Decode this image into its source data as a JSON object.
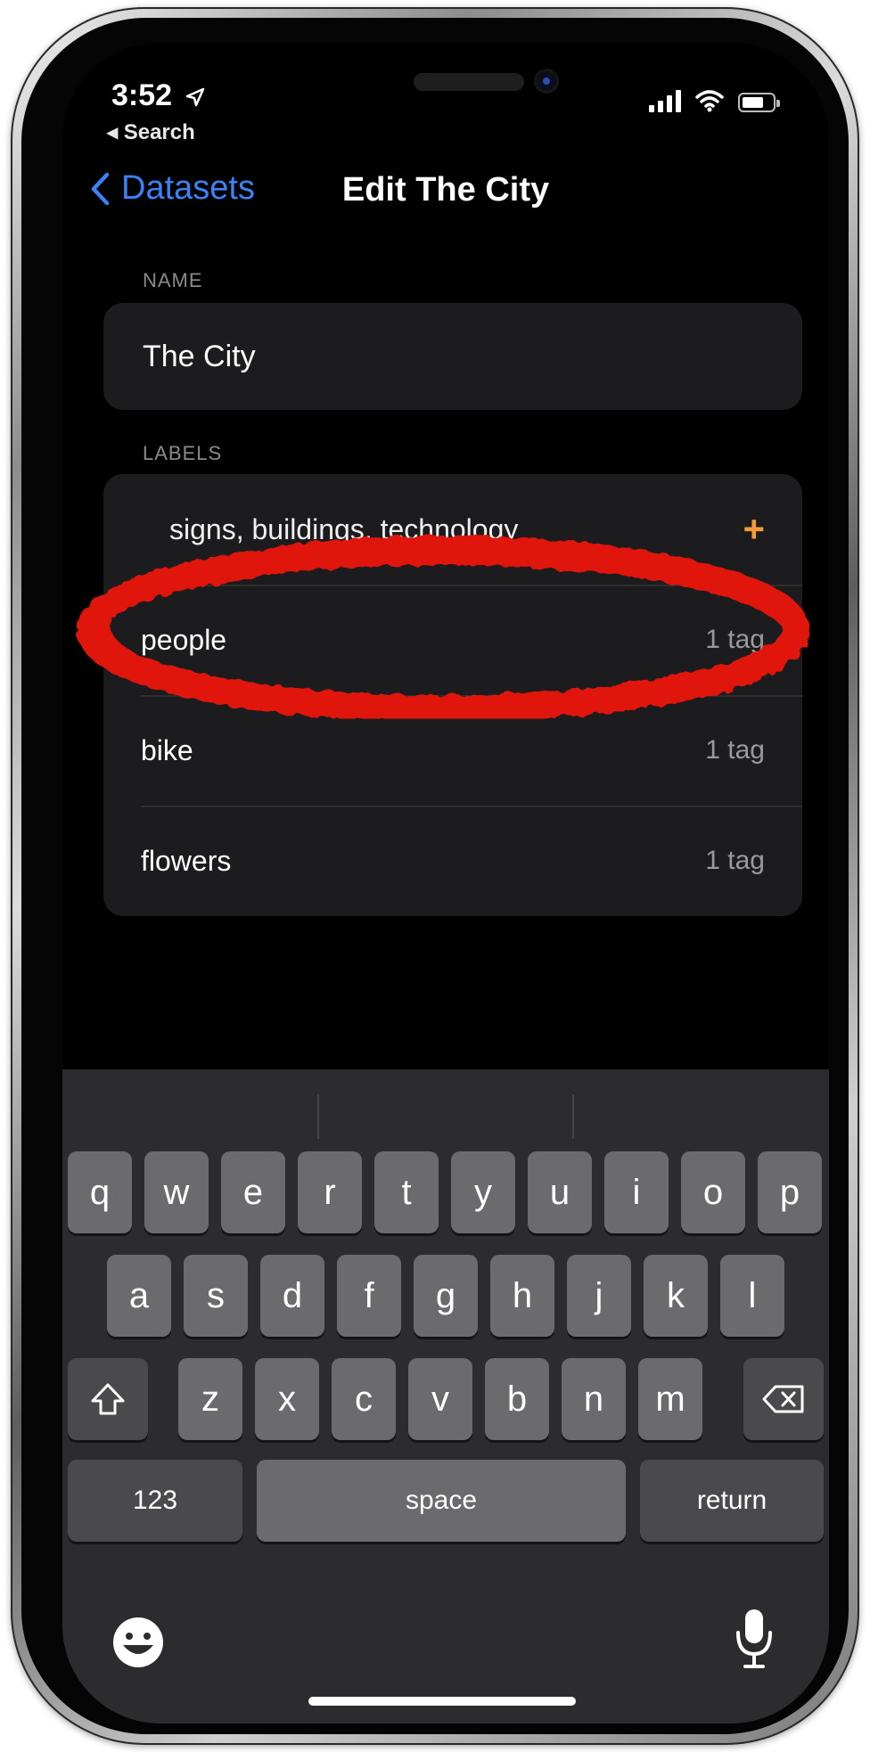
{
  "status": {
    "time": "3:52",
    "back_app": "◂ Search"
  },
  "nav": {
    "back_label": "Datasets",
    "title": "Edit The City"
  },
  "name_section": {
    "header": "NAME",
    "value": "The City"
  },
  "labels_section": {
    "header": "LABELS",
    "new_label_value": "signs, buildings, technology",
    "add_icon": "plus-icon",
    "items": [
      {
        "label": "people",
        "count": "1 tag"
      },
      {
        "label": "bike",
        "count": "1 tag"
      },
      {
        "label": "flowers",
        "count": "1 tag"
      }
    ]
  },
  "keyboard": {
    "row1": [
      "q",
      "w",
      "e",
      "r",
      "t",
      "y",
      "u",
      "i",
      "o",
      "p"
    ],
    "row2": [
      "a",
      "s",
      "d",
      "f",
      "g",
      "h",
      "j",
      "k",
      "l"
    ],
    "row3": [
      "z",
      "x",
      "c",
      "v",
      "b",
      "n",
      "m"
    ],
    "numbers_key": "123",
    "space_key": "space",
    "return_key": "return"
  },
  "colors": {
    "accent_blue": "#3b82f6",
    "plus_orange": "#f29b38",
    "annotation_red": "#e0160c"
  }
}
